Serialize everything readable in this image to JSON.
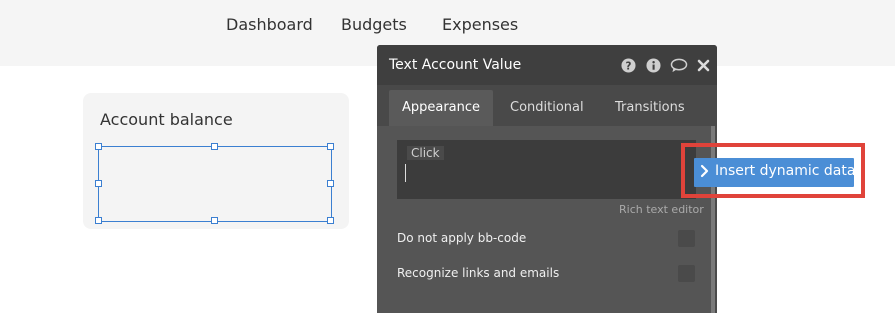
{
  "nav": {
    "dashboard": "Dashboard",
    "budgets": "Budgets",
    "expenses": "Expenses"
  },
  "card": {
    "title": "Account balance"
  },
  "panel": {
    "title": "Text Account Value",
    "icons": [
      "question-icon",
      "info-icon",
      "comment-icon",
      "close-icon"
    ],
    "tabs": [
      "Appearance",
      "Conditional",
      "Transitions"
    ],
    "active_tab": "Appearance",
    "editor_chip": "Click",
    "rich_text_label": "Rich text editor",
    "rows": [
      {
        "label": "Do not apply bb-code",
        "checked": false
      },
      {
        "label": "Recognize links and emails",
        "checked": false
      }
    ]
  },
  "dynamic_button": {
    "label": "Insert dynamic data"
  },
  "colors": {
    "highlight": "#e0433a",
    "button": "#4b8ed6",
    "panel": "#555555"
  }
}
